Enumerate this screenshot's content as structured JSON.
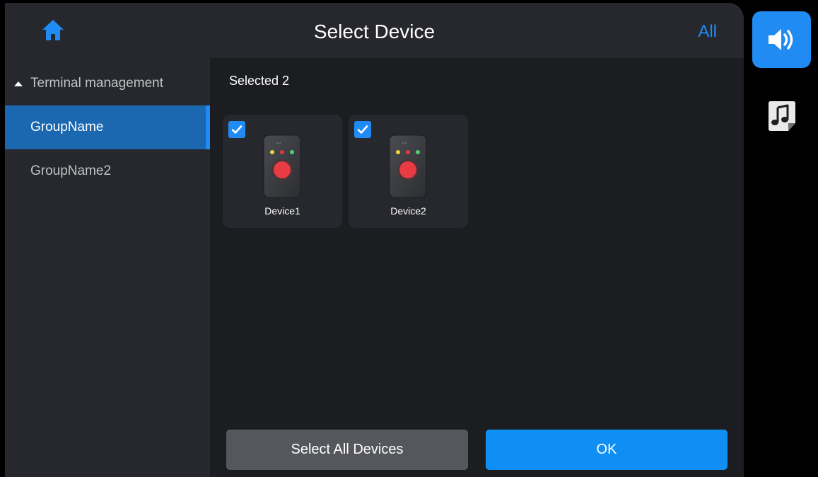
{
  "header": {
    "title": "Select Device",
    "all_label": "All",
    "home_icon": "home-icon",
    "accent_color": "#1f8bf3"
  },
  "sidebar": {
    "tree_label": "Terminal management",
    "groups": [
      {
        "label": "GroupName",
        "selected": true
      },
      {
        "label": "GroupName2",
        "selected": false
      }
    ]
  },
  "content": {
    "selected_text": "Selected 2",
    "devices": [
      {
        "name": "Device1",
        "checked": true
      },
      {
        "name": "Device2",
        "checked": true
      }
    ]
  },
  "footer": {
    "select_all_label": "Select All Devices",
    "ok_label": "OK"
  },
  "side_controls": {
    "speaker_icon": "speaker-icon",
    "music_icon": "music-note-icon"
  }
}
